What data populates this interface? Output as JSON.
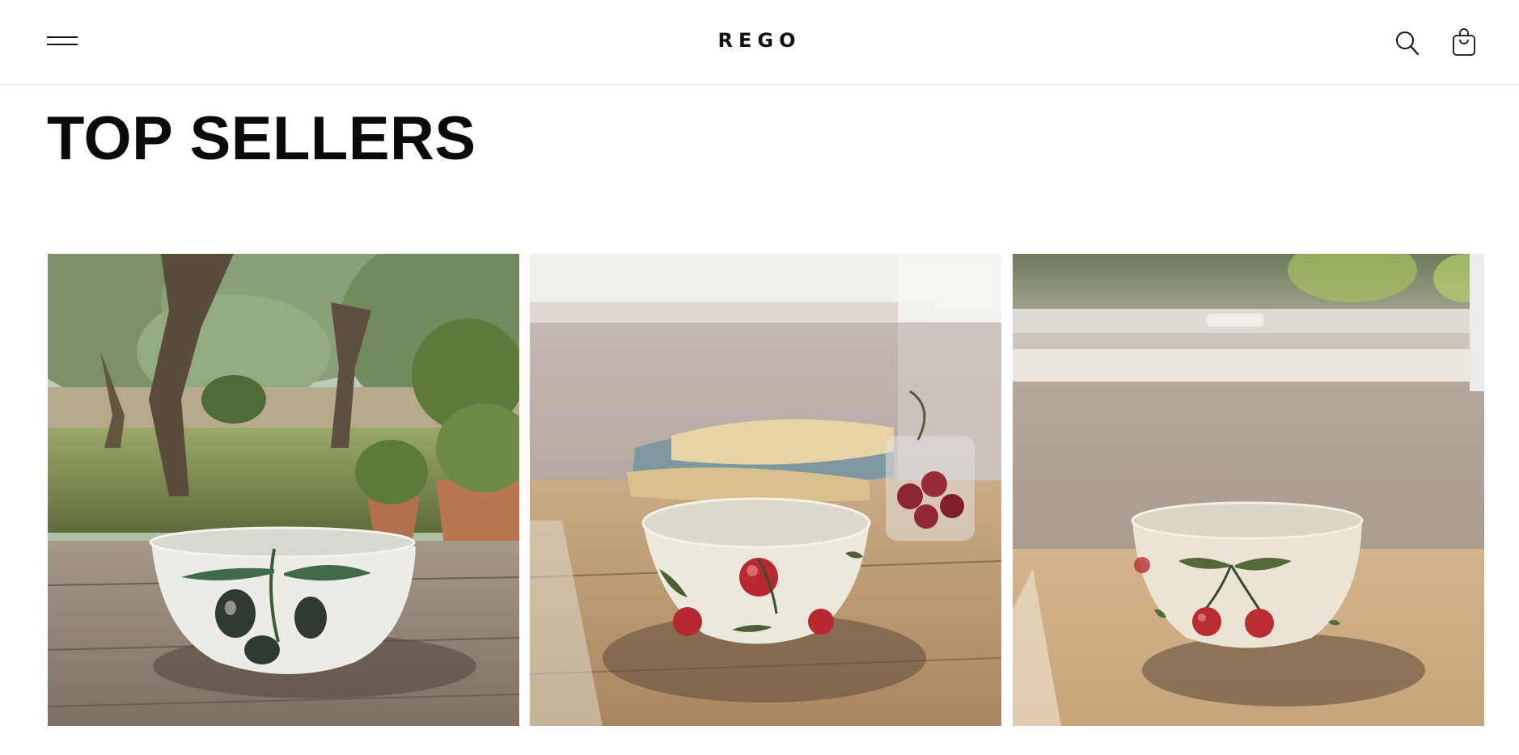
{
  "header": {
    "logo": "REGO",
    "menu_icon": "menu-icon",
    "search_icon": "search-icon",
    "cart_icon": "shopping-bag-icon"
  },
  "section": {
    "title": "TOP SELLERS"
  },
  "products": [
    {
      "image": "olive-bowl-garden-photo"
    },
    {
      "image": "cherry-bowl-table-photo"
    },
    {
      "image": "cherry-bowl-window-photo"
    }
  ],
  "colors": {
    "text": "#111111",
    "border": "#e6e6e6",
    "background": "#ffffff"
  }
}
